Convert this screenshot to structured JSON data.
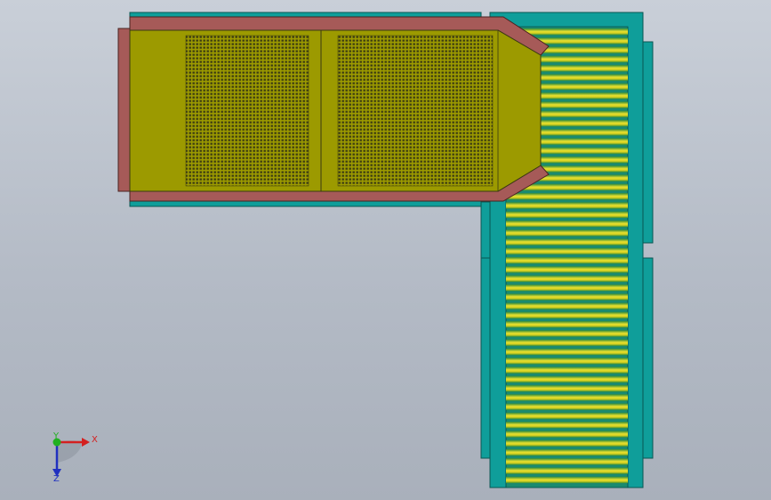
{
  "viewport": {
    "background_top": "#c9cfd8",
    "background_bottom": "#a9b0bb"
  },
  "model": {
    "colors": {
      "frame_teal": "#0f9e9a",
      "frame_edge": "#0a5652",
      "rail_brown": "#a65a58",
      "hopper_olive": "#9c9a00",
      "mesh_dark": "#3a3a12",
      "roller_yellow": "#e6e030",
      "roller_green": "#2f8a3a"
    },
    "screen_panels": 2,
    "rollers_upper_section": 15,
    "rollers_lower_section": 35
  },
  "triad": {
    "x_label": "X",
    "y_label": "Y",
    "z_label": "Z",
    "x_color": "#d42020",
    "y_color": "#20b020",
    "z_color": "#2030c0"
  }
}
